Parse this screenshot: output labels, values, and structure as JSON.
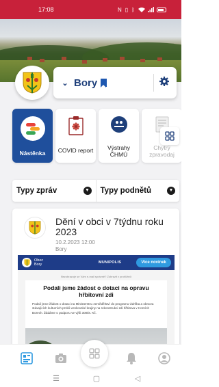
{
  "status_bar": {
    "time": "17:08",
    "icons": [
      "nfc-icon",
      "vibrate-icon",
      "bluetooth-icon",
      "wifi-icon",
      "signal-icon",
      "battery-icon"
    ]
  },
  "header": {
    "village_name": "Bory",
    "bookmark_icon": "bookmark-icon",
    "dropdown_icon": "chevron-down-icon",
    "settings_icon": "gear-icon"
  },
  "feature_tiles": [
    {
      "label": "Nástěnka",
      "icon": "noticeboard-icon",
      "active": true
    },
    {
      "label": "COVID report",
      "icon": "covid-report-icon",
      "active": false
    },
    {
      "label": "Výstrahy ČHMÚ",
      "icon": "chmu-alert-icon",
      "active": false
    },
    {
      "label": "Chytrý zpravodaj",
      "icon": "newsletter-icon",
      "active": false
    }
  ],
  "filters": {
    "news_types": "Typy zpráv",
    "report_types": "Typy podnětů"
  },
  "news": [
    {
      "title": "Dění v obci v 7týdnu roku 2023",
      "date": "10.2.2023 12:00",
      "author": "Bory",
      "preview": {
        "obec_label": "Obec",
        "obec_name": "Bory",
        "platform": "MUNIPOLIS",
        "more_button": "Více novinek",
        "banner": "Nezobrazuje se Vám e-mail správně? Zobrazit v prohlížeči",
        "headline": "Podali jsme žádost o dotaci na opravu hřbitovní zdi",
        "body": "Podali jsme žádost o dotaci na Ministerstvu zemědělství do programu Údržba a obnova stávajících kulturních prvků venkovské krajiny na rekonstrukci zdi hřbitova v Horních Borech. Žádáme o podporu ve výši 300tis. Kč."
      }
    }
  ],
  "bottom_nav": [
    {
      "name": "nav-noticeboard",
      "icon": "noticeboard-icon",
      "active": true
    },
    {
      "name": "nav-camera",
      "icon": "camera-icon",
      "active": false
    },
    {
      "name": "nav-apps",
      "icon": "apps-grid-icon",
      "active": false
    },
    {
      "name": "nav-notifications",
      "icon": "bell-icon",
      "active": false
    },
    {
      "name": "nav-profile",
      "icon": "user-icon",
      "active": false
    }
  ],
  "colors": {
    "status_bar": "#c8213a",
    "primary": "#1f4f9c",
    "brand_dark": "#1e3f7a",
    "preview_header": "#1e3c88",
    "preview_button": "#2f9ae0"
  }
}
